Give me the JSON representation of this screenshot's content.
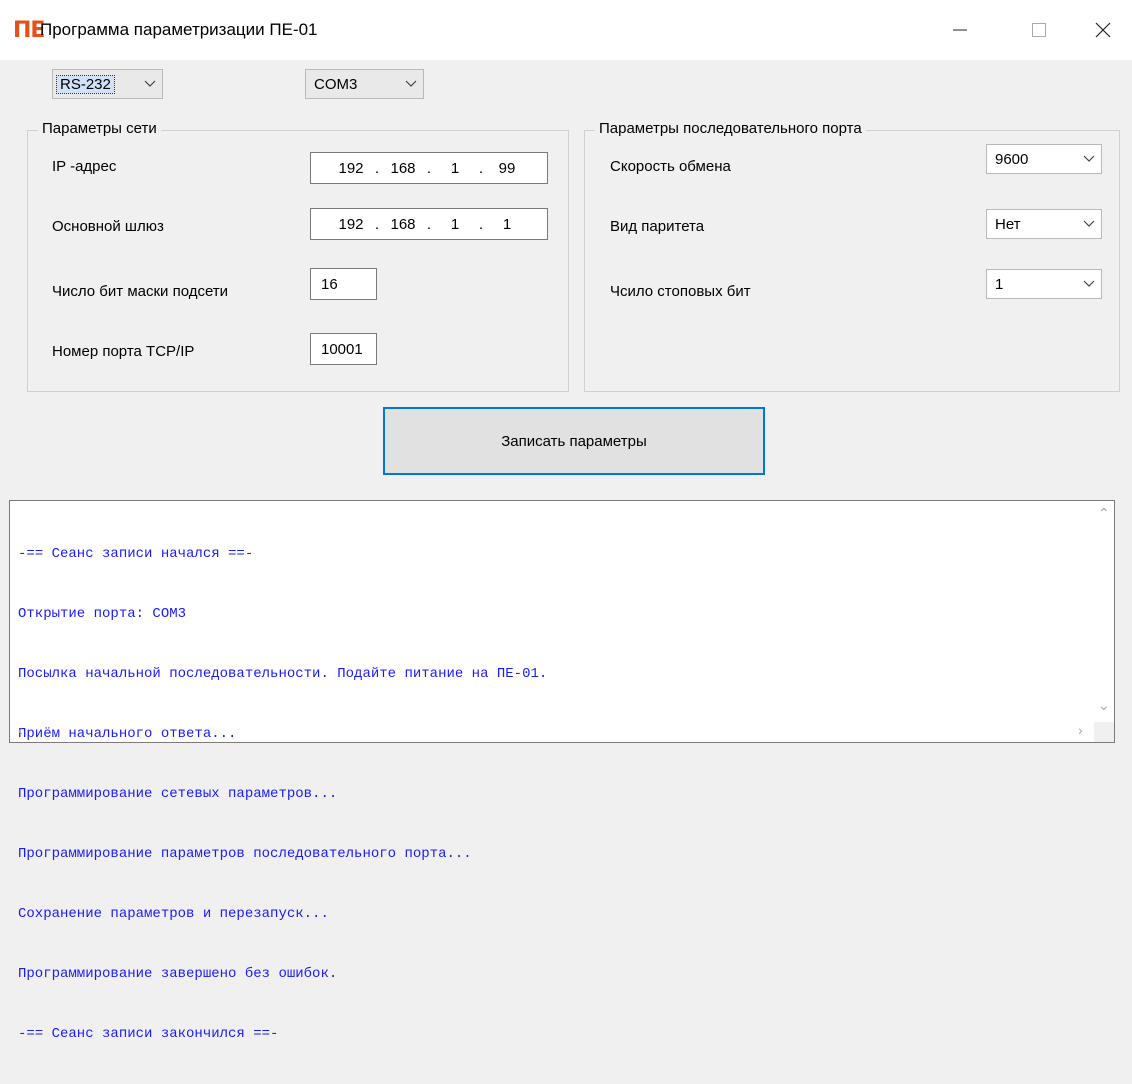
{
  "window": {
    "logo": "ПЕ",
    "title": "Программа параметризации ПЕ-01"
  },
  "top": {
    "interface_select": "RS-232",
    "port_select": "COM3"
  },
  "network": {
    "legend": "Параметры сети",
    "ip_label": "IP -адрес",
    "ip": [
      "192",
      "168",
      "1",
      "99"
    ],
    "gateway_label": "Основной шлюз",
    "gateway": [
      "192",
      "168",
      "1",
      "1"
    ],
    "mask_label": "Число бит маски подсети",
    "mask": "16",
    "port_label": "Номер порта TCP/IP",
    "port": "10001"
  },
  "serial": {
    "legend": "Параметры последовательного порта",
    "speed_label": "Скорость обмена",
    "speed": "9600",
    "parity_label": "Вид паритета",
    "parity": "Нет",
    "stopbits_label": "Чсило стоповых бит",
    "stopbits": "1"
  },
  "write_button": "Записать параметры",
  "log": [
    "-== Сеанс записи начался ==-",
    "Открытие порта: COM3",
    "Посылка начальной последовательности. Подайте питание на ПЕ-01.",
    "Приём начального ответа...",
    "Программирование сетевых параметров...",
    "Программирование параметров последовательного порта...",
    "Сохранение параметров и перезапуск...",
    "Программирование завершено без ошибок.",
    "-== Сеанс записи закончился ==-"
  ],
  "colors": {
    "log_text": "#1a1aff",
    "logo": "#e8501a",
    "focus_border": "#0078d7"
  }
}
